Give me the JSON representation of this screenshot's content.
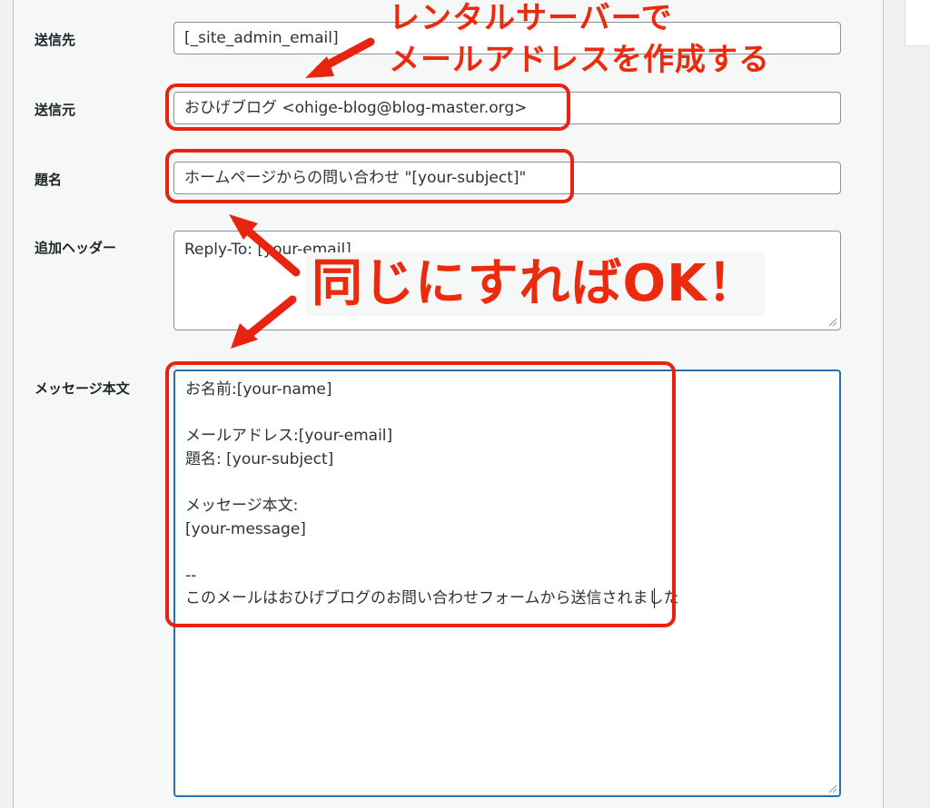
{
  "form": {
    "to": {
      "label": "送信先",
      "value": "[_site_admin_email]"
    },
    "from": {
      "label": "送信元",
      "value": "おひげブログ <ohige-blog@blog-master.org>"
    },
    "subject": {
      "label": "題名",
      "value": "ホームページからの問い合わせ \"[your-subject]\""
    },
    "headers": {
      "label": "追加ヘッダー",
      "value": "Reply-To: [your-email]"
    },
    "body": {
      "label": "メッセージ本文",
      "value": "お名前:[your-name]\n\nメールアドレス:[your-email]\n題名: [your-subject]\n\nメッセージ本文:\n[your-message]\n\n--\nこのメールはおひげブログのお問い合わせフォームから送信されました"
    }
  },
  "annotations": {
    "note_top_line1": "レンタルサーバーで",
    "note_top_line2": "メールアドレスを作成する",
    "note_middle": "同じにすればOK！",
    "color": "#e8230f"
  },
  "colors": {
    "panel_bg": "#f6f7f7",
    "field_border": "#8c8f94",
    "focus_border": "#2271b1"
  }
}
